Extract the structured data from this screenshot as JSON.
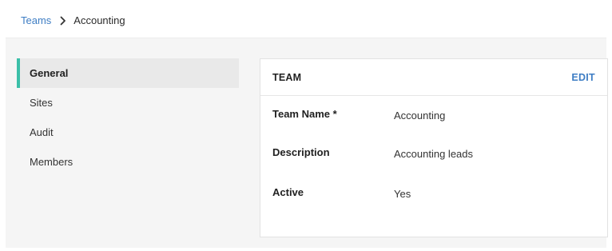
{
  "breadcrumb": {
    "parent": "Teams",
    "current": "Accounting"
  },
  "icons": {
    "separator": "chevron-right-icon"
  },
  "sidebar": {
    "items": [
      {
        "label": "General",
        "active": true
      },
      {
        "label": "Sites",
        "active": false
      },
      {
        "label": "Audit",
        "active": false
      },
      {
        "label": "Members",
        "active": false
      }
    ]
  },
  "card": {
    "title": "TEAM",
    "edit_label": "EDIT",
    "fields": [
      {
        "label": "Team Name *",
        "value": "Accounting"
      },
      {
        "label": "Description",
        "value": "Accounting leads"
      },
      {
        "label": "Active",
        "value": "Yes"
      }
    ]
  },
  "colors": {
    "accent": "#3bbfa8",
    "link": "#3f7ec4",
    "active_bg": "#e9e9e9"
  }
}
